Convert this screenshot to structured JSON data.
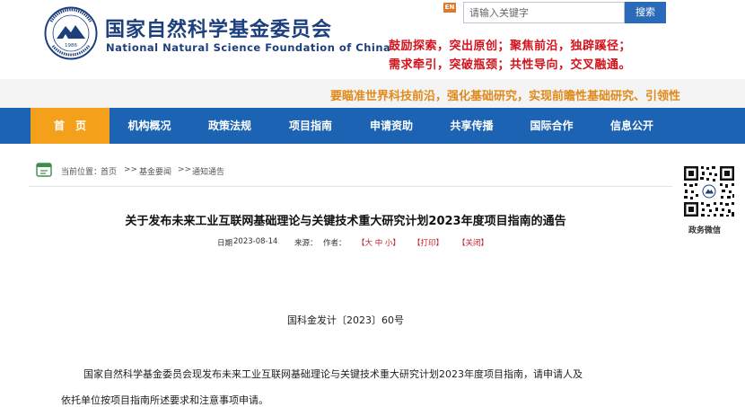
{
  "header": {
    "org_name_cn": "国家自然科学基金委员会",
    "org_name_en": "National Natural Science Foundation of China",
    "logo_year": "1986",
    "en_badge": "EN",
    "search": {
      "placeholder": "请输入关键字",
      "button_label": "搜索"
    },
    "motto_line1": "鼓励探索，突出原创；聚焦前沿，独辟蹊径；",
    "motto_line2": "需求牵引，突破瓶颈；共性导向，交叉融通。",
    "accent_color": "#1c63b4",
    "motto_color": "#d3121b"
  },
  "slogan": "要瞄准世界科技前沿，强化基础研究，实现前瞻性基础研究、引领性",
  "nav": {
    "items": [
      {
        "label": "首　页",
        "active": true
      },
      {
        "label": "机构概况"
      },
      {
        "label": "政策法规"
      },
      {
        "label": "项目指南"
      },
      {
        "label": "申请资助"
      },
      {
        "label": "共享传播"
      },
      {
        "label": "国际合作"
      },
      {
        "label": "信息公开"
      }
    ]
  },
  "breadcrumb": {
    "prefix": "当前位置：",
    "items": [
      "首页",
      "基金要闻",
      "通知通告"
    ],
    "separator": ">>"
  },
  "sidebar": {
    "qr_label": "政务微信"
  },
  "article": {
    "title": "关于发布未来工业互联网基础理论与关键技术重大研究计划2023年度项目指南的通告",
    "date_label": "日期",
    "date": "2023-08-14",
    "source_label": "来源：",
    "author_label": "作者：",
    "font_size_label": "【大 中 小】",
    "print_label": "【打印】",
    "close_label": "【关闭】",
    "doc_number": "国科金发计〔2023〕60号",
    "paragraph_line1": "国家自然科学基金委员会现发布未来工业互联网基础理论与关键技术重大研究计划2023年度项目指南，请申请人及",
    "paragraph_line2": "依托单位按项目指南所述要求和注意事项申请。"
  }
}
